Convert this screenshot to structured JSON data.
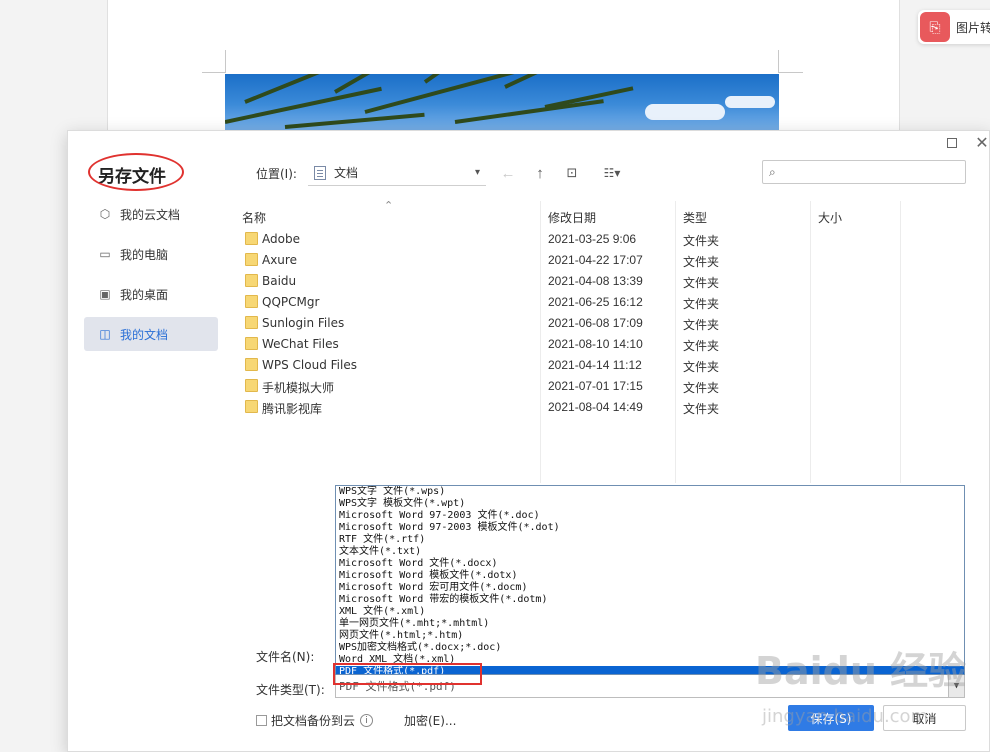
{
  "side_panel": {
    "label": "图片转"
  },
  "dialog": {
    "title": "另存文件",
    "nav": [
      {
        "label": "我的云文档",
        "icon": "cloud-doc-icon"
      },
      {
        "label": "我的电脑",
        "icon": "computer-icon"
      },
      {
        "label": "我的桌面",
        "icon": "desktop-icon"
      },
      {
        "label": "我的文档",
        "icon": "documents-icon",
        "active": true
      }
    ],
    "location": {
      "label": "位置(I):",
      "value": "文档"
    },
    "search": {
      "placeholder": ""
    },
    "table": {
      "headers": {
        "name": "名称",
        "modified": "修改日期",
        "type": "类型",
        "size": "大小"
      },
      "rows": [
        {
          "name": "Adobe",
          "modified": "2021-03-25 9:06",
          "type": "文件夹"
        },
        {
          "name": "Axure",
          "modified": "2021-04-22 17:07",
          "type": "文件夹"
        },
        {
          "name": "Baidu",
          "modified": "2021-04-08 13:39",
          "type": "文件夹"
        },
        {
          "name": "QQPCMgr",
          "modified": "2021-06-25 16:12",
          "type": "文件夹"
        },
        {
          "name": "Sunlogin Files",
          "modified": "2021-06-08 17:09",
          "type": "文件夹"
        },
        {
          "name": "WeChat Files",
          "modified": "2021-08-10 14:10",
          "type": "文件夹"
        },
        {
          "name": "WPS Cloud Files",
          "modified": "2021-04-14 11:12",
          "type": "文件夹"
        },
        {
          "name": "手机模拟大师",
          "modified": "2021-07-01 17:15",
          "type": "文件夹"
        },
        {
          "name": "腾讯影视库",
          "modified": "2021-08-04 14:49",
          "type": "文件夹"
        }
      ]
    },
    "filename_label": "文件名(N):",
    "filetype_label": "文件类型(T):",
    "filetype_value": "PDF 文件格式(*.pdf)",
    "filetype_options": [
      "WPS文字 文件(*.wps)",
      "WPS文字 模板文件(*.wpt)",
      "Microsoft Word 97-2003 文件(*.doc)",
      "Microsoft Word 97-2003 模板文件(*.dot)",
      "RTF 文件(*.rtf)",
      "文本文件(*.txt)",
      "Microsoft Word 文件(*.docx)",
      "Microsoft Word 模板文件(*.dotx)",
      "Microsoft Word 宏可用文件(*.docm)",
      "Microsoft Word 带宏的模板文件(*.dotm)",
      "XML 文件(*.xml)",
      "单一网页文件(*.mht;*.mhtml)",
      "网页文件(*.html;*.htm)",
      "WPS加密文档格式(*.docx;*.doc)",
      "Word XML 文档(*.xml)",
      "PDF 文件格式(*.pdf)"
    ],
    "backup_label": "把文档备份到云",
    "encrypt_label": "加密(E)...",
    "save_label": "保存(S)",
    "cancel_label": "取消"
  },
  "watermark": {
    "text": "Baidu 经验",
    "sub": "jingyan.baidu.com"
  },
  "colors": {
    "accent": "#2f7be5",
    "selection": "#0a64d2",
    "annotation": "#e0322f"
  }
}
